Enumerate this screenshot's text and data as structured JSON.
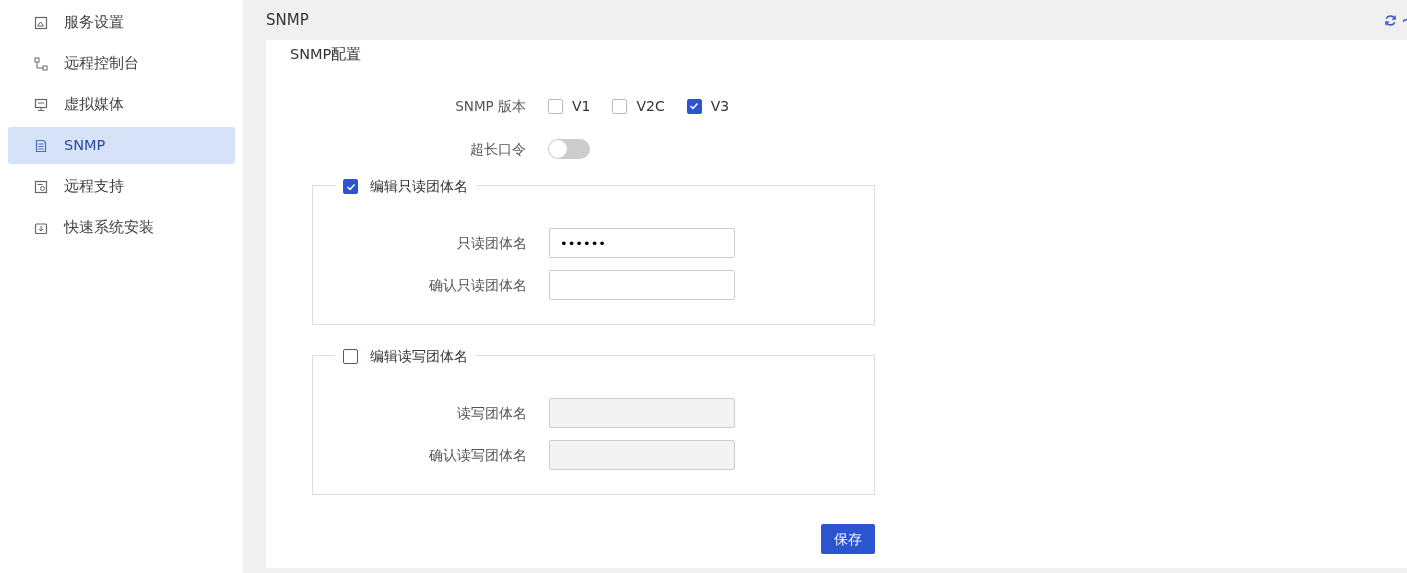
{
  "sidebar": {
    "items": [
      {
        "label": "服务设置",
        "selected": false
      },
      {
        "label": "远程控制台",
        "selected": false
      },
      {
        "label": "虚拟媒体",
        "selected": false
      },
      {
        "label": "SNMP",
        "selected": true
      },
      {
        "label": "远程支持",
        "selected": false
      },
      {
        "label": "快速系统安装",
        "selected": false
      }
    ]
  },
  "header": {
    "title": "SNMP"
  },
  "panel": {
    "title": "SNMP配置",
    "version": {
      "label": "SNMP 版本",
      "options": [
        {
          "label": "V1",
          "checked": false
        },
        {
          "label": "V2C",
          "checked": false
        },
        {
          "label": "V3",
          "checked": true
        }
      ]
    },
    "long_password": {
      "label": "超长口令",
      "on": false
    },
    "groups": [
      {
        "title": "编辑只读团体名",
        "checked": true,
        "fields": [
          {
            "label": "只读团体名",
            "value": "••••••",
            "disabled": false
          },
          {
            "label": "确认只读团体名",
            "disabled": false
          }
        ]
      },
      {
        "title": "编辑读写团体名",
        "checked": false,
        "fields": [
          {
            "label": "读写团体名",
            "disabled": true
          },
          {
            "label": "确认读写团体名",
            "disabled": true
          }
        ]
      }
    ],
    "save_button": "保存"
  }
}
